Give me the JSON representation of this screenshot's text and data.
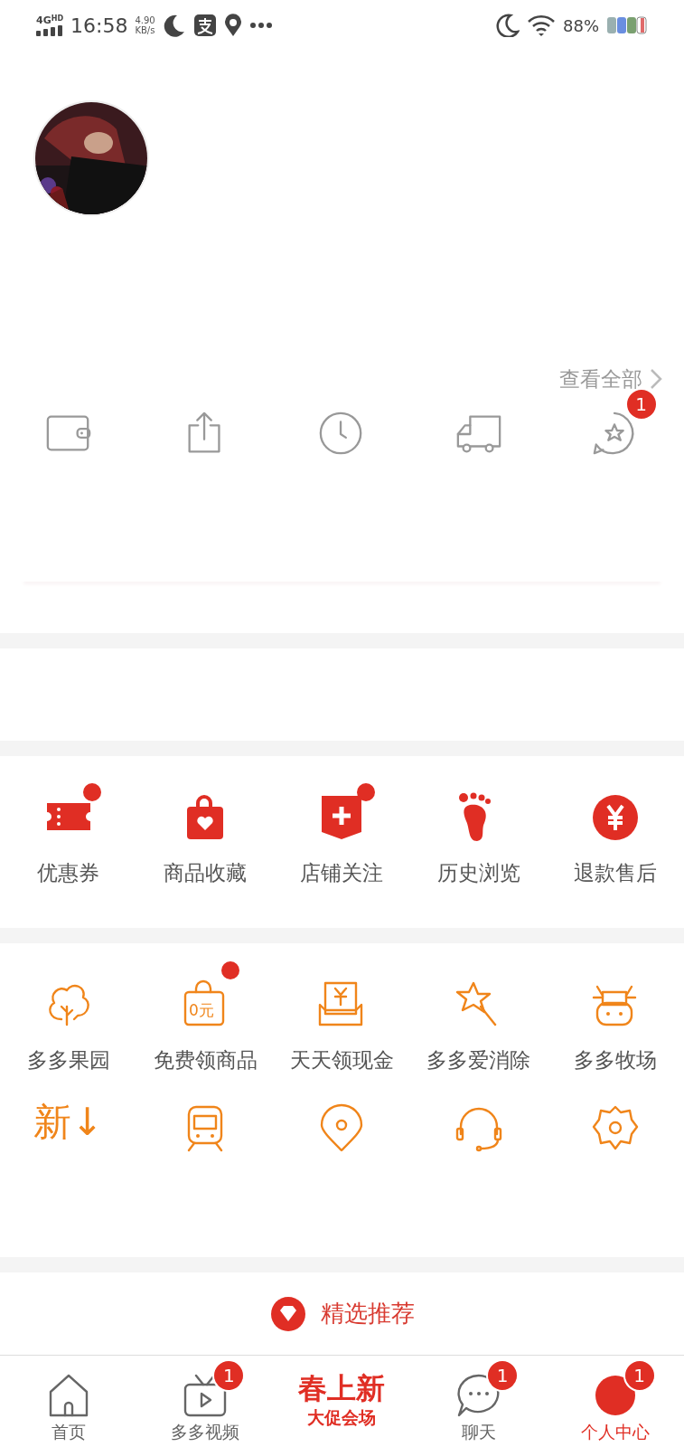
{
  "status_bar": {
    "network": "4G",
    "network_hd": "HD",
    "time": "16:58",
    "speed": "4.90",
    "speed_unit": "KB/s",
    "battery": "88%"
  },
  "view_all": "查看全部",
  "order_shortcuts": [
    {
      "kind": "wallet"
    },
    {
      "kind": "share"
    },
    {
      "kind": "clock"
    },
    {
      "kind": "truck"
    },
    {
      "kind": "review",
      "badge": "1"
    }
  ],
  "services": [
    {
      "label": "优惠券",
      "kind": "coupon",
      "dot": true
    },
    {
      "label": "商品收藏",
      "kind": "bag",
      "dot": false
    },
    {
      "label": "店铺关注",
      "kind": "shop",
      "dot": true
    },
    {
      "label": "历史浏览",
      "kind": "foot",
      "dot": false
    },
    {
      "label": "退款售后",
      "kind": "yuan",
      "dot": false
    }
  ],
  "apps": [
    {
      "label": "多多果园",
      "kind": "tree",
      "dot": false
    },
    {
      "label": "免费领商品",
      "kind": "freebag",
      "icon_text": "0元",
      "dot": true
    },
    {
      "label": "天天领现金",
      "kind": "cash",
      "dot": false
    },
    {
      "label": "多多爱消除",
      "kind": "wand",
      "dot": false
    },
    {
      "label": "多多牧场",
      "kind": "cow",
      "dot": false
    },
    {
      "kind": "glyph",
      "glyph": "新↓",
      "dot": false
    },
    {
      "kind": "train",
      "dot": false
    },
    {
      "kind": "pin",
      "dot": false
    },
    {
      "kind": "headset",
      "dot": false
    },
    {
      "kind": "gear",
      "dot": false
    }
  ],
  "recommend": "精选推荐",
  "tab_bar": [
    {
      "kind": "home",
      "label": "首页",
      "selected": false
    },
    {
      "kind": "video",
      "label": "多多视频",
      "badge": "1",
      "selected": false
    },
    {
      "kind": "promo",
      "title": "春上新",
      "subtitle": "大促会场",
      "selected": false
    },
    {
      "kind": "chat",
      "label": "聊天",
      "badge": "1",
      "selected": false
    },
    {
      "kind": "profile",
      "label": "个人中心",
      "badge": "1",
      "selected": true
    }
  ]
}
